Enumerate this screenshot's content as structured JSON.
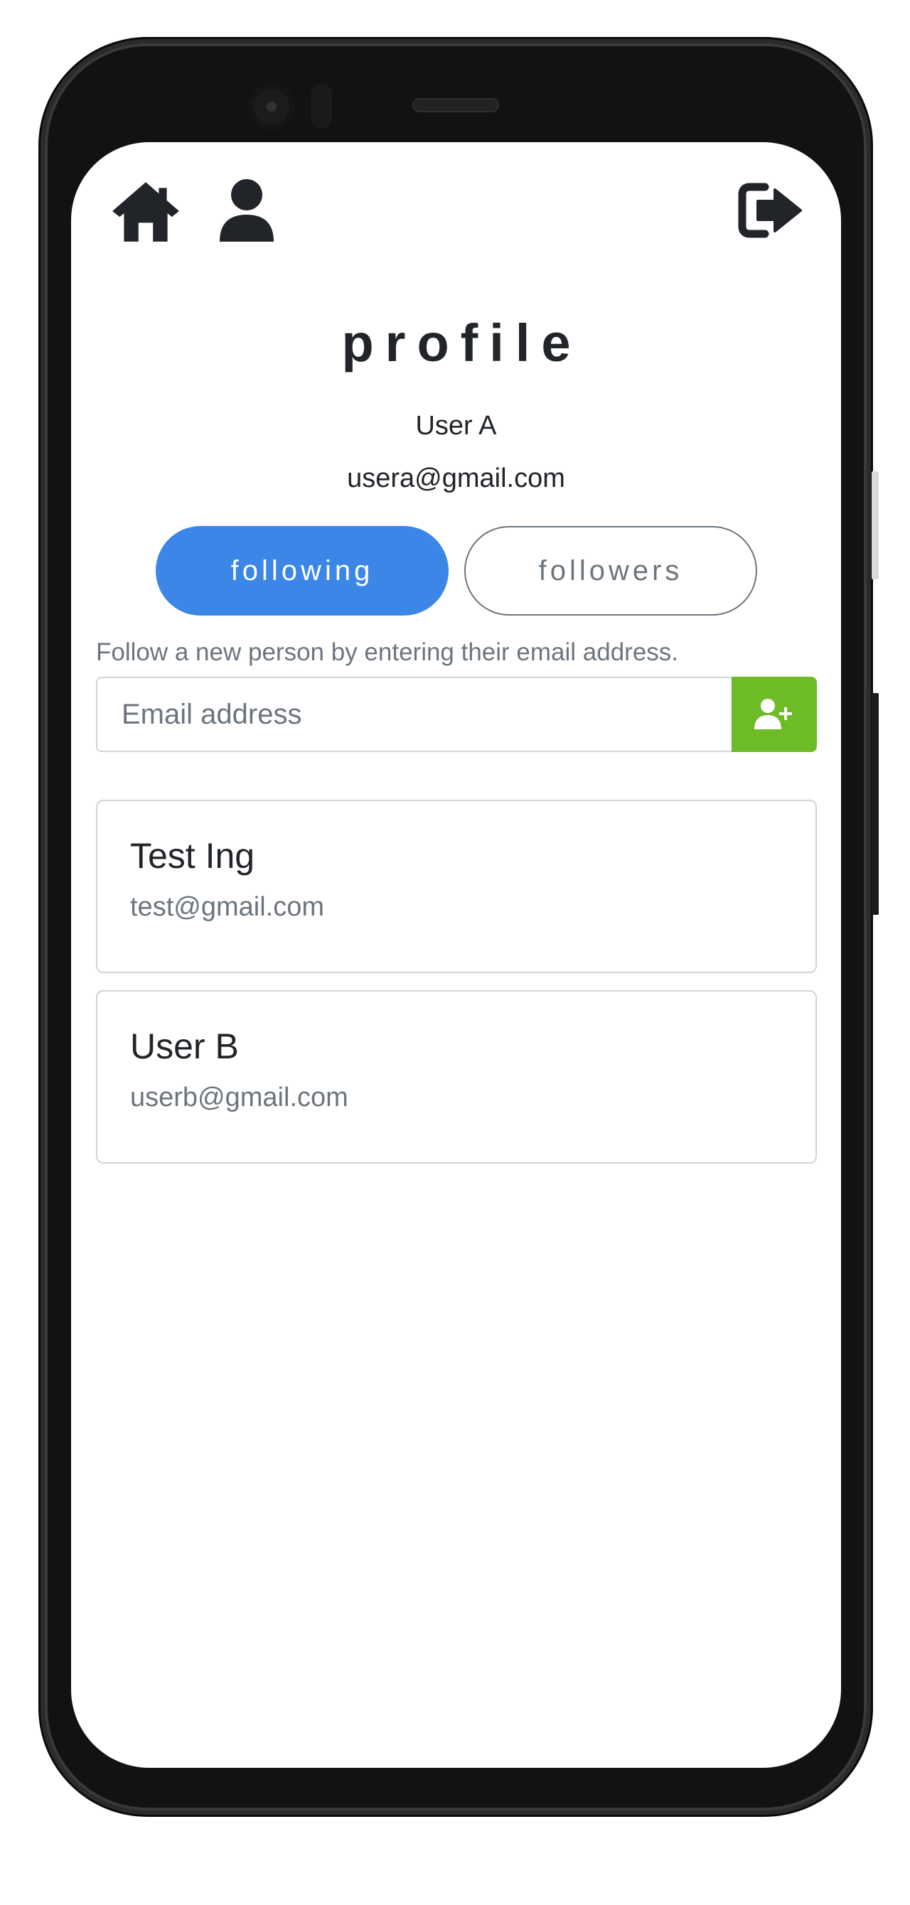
{
  "nav": {
    "home_icon": "home-icon",
    "profile_icon": "user-icon",
    "logout_icon": "sign-out-icon"
  },
  "profile": {
    "title": "profile",
    "user_name": "User A",
    "user_email": "usera@gmail.com"
  },
  "tabs": {
    "following_label": "following",
    "followers_label": "followers",
    "active": "following"
  },
  "follow_form": {
    "help_text": "Follow a new person by entering their email address.",
    "input_placeholder": "Email address",
    "input_value": "",
    "button_icon": "user-plus-icon"
  },
  "people": [
    {
      "name": "Test Ing",
      "email": "test@gmail.com"
    },
    {
      "name": "User B",
      "email": "userb@gmail.com"
    }
  ],
  "colors": {
    "primary": "#3b86e6",
    "success": "#6dbb26",
    "text": "#212529",
    "muted": "#6c757d"
  }
}
